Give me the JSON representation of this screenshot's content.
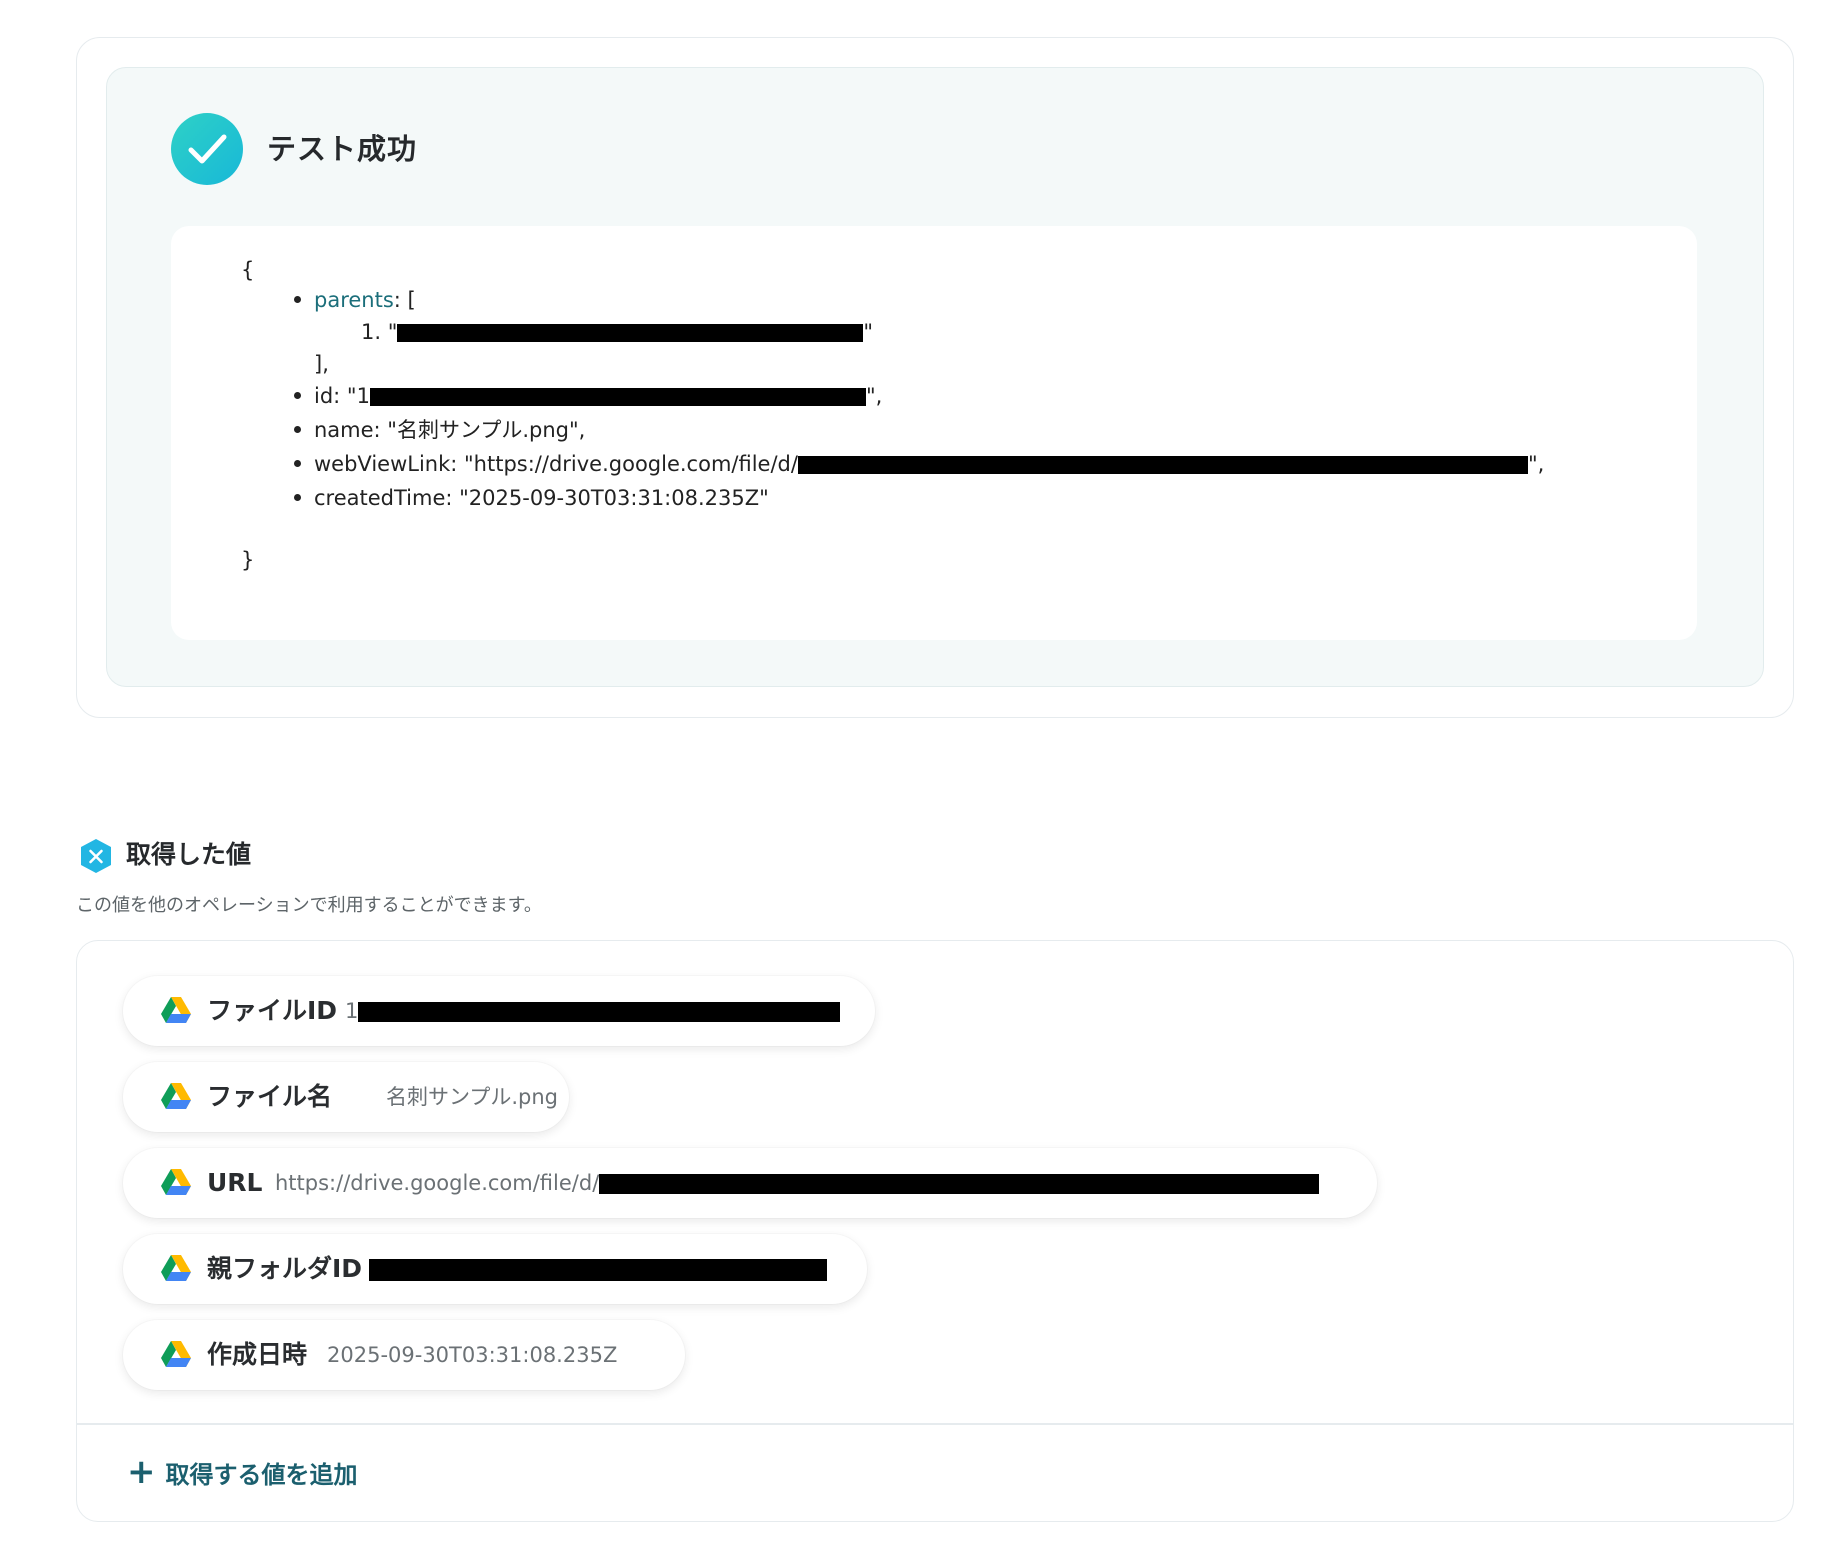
{
  "test_result": {
    "title": "テスト成功",
    "json": {
      "open_brace": "{",
      "close_brace": "}",
      "parents_key": "parents",
      "parents_open": ": [",
      "parents_item_index": "1.",
      "parents_close": "],",
      "id_prefix": "id: \"1",
      "id_suffix": "\",",
      "name_line": "name: \"名刺サンプル.png\",",
      "webview_prefix": "webViewLink: \"https://drive.google.com/file/d/",
      "webview_suffix": "\",",
      "created_line": "createdTime: \"2025-09-30T03:31:08.235Z\""
    }
  },
  "obtained": {
    "title": "取得した値",
    "description": "この値を他のオペレーションで利用することができます。",
    "items": [
      {
        "label": "ファイルID",
        "value": "1"
      },
      {
        "label": "ファイル名",
        "value": "名刺サンプル.png"
      },
      {
        "label": "URL",
        "value": "https://drive.google.com/file/d/"
      },
      {
        "label": "親フォルダID",
        "value": ""
      },
      {
        "label": "作成日時",
        "value": "2025-09-30T03:31:08.235Z"
      }
    ],
    "add_button_label": "取得する値を追加",
    "add_button_icon": "plus-icon"
  },
  "colors": {
    "accent_teal": "#1b5f6e",
    "success_gradient_start": "#2ed1c6",
    "success_gradient_end": "#18b8d8"
  }
}
